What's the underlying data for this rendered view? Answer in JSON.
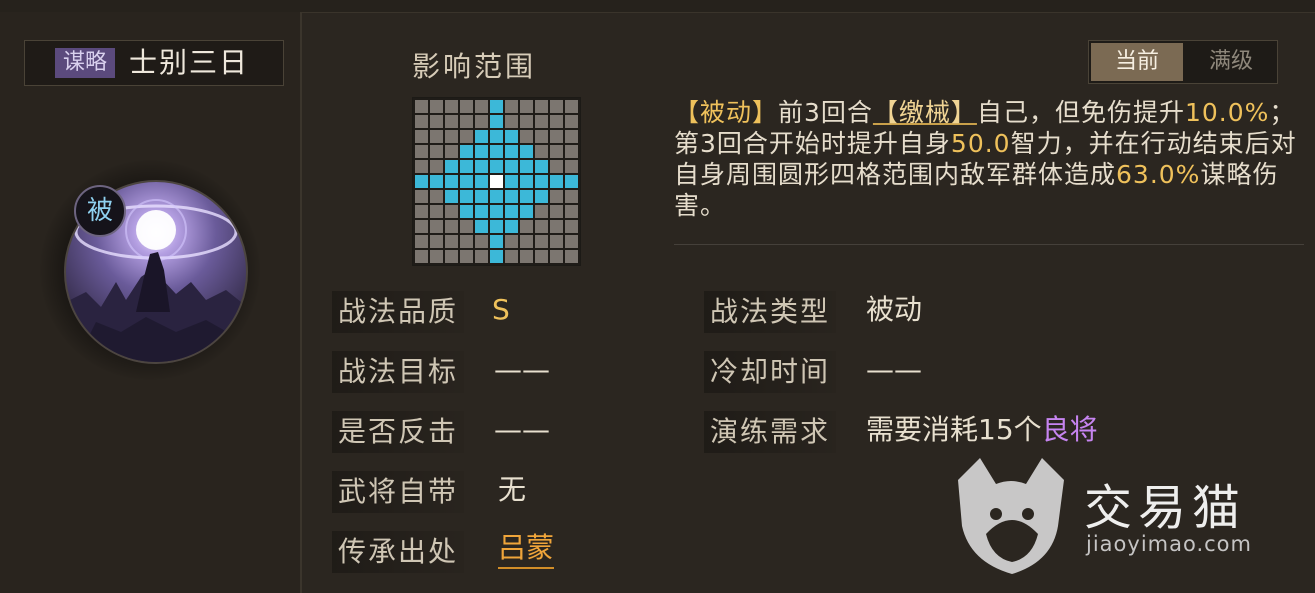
{
  "skill": {
    "category": "谋略",
    "name": "士别三日",
    "type_badge": "被"
  },
  "range": {
    "label": "影响范围",
    "grid_size": 11,
    "radius": 4
  },
  "toggle": {
    "current": "当前",
    "max_level": "满级"
  },
  "description": {
    "p1": "【被动】",
    "p2": "前3回合",
    "p3": "【缴械】",
    "p4": "自己，但免伤提升",
    "p5": "10.0%",
    "p6": "；第3回合开始时提升自身",
    "p7": "50.0",
    "p8": "智力，并在行动结束后对自身周围圆形四格范围内敌军群体造成",
    "p9": "63.0%",
    "p10": "谋略伤害。"
  },
  "attributes": {
    "quality_label": "战法品质",
    "quality_value": "S",
    "type_label": "战法类型",
    "type_value": "被动",
    "target_label": "战法目标",
    "target_value": "——",
    "cooldown_label": "冷却时间",
    "cooldown_value": "——",
    "counter_label": "是否反击",
    "counter_value": "——",
    "training_label": "演练需求",
    "training_value_prefix": "需要消耗15个",
    "training_value_highlight": "良将",
    "innate_label": "武将自带",
    "innate_value": "无",
    "source_label": "传承出处",
    "source_value": "吕蒙"
  },
  "watermark": {
    "brand": "交易猫",
    "url": "jiaoyimao.com"
  },
  "colors": {
    "gold": "#efc15b",
    "purple_highlight": "#c684f0",
    "orange_link": "#f0a53a",
    "grid_active": "#3cb8d8",
    "grid_inactive": "#7c7670",
    "category_badge": "#5b4a7d"
  }
}
